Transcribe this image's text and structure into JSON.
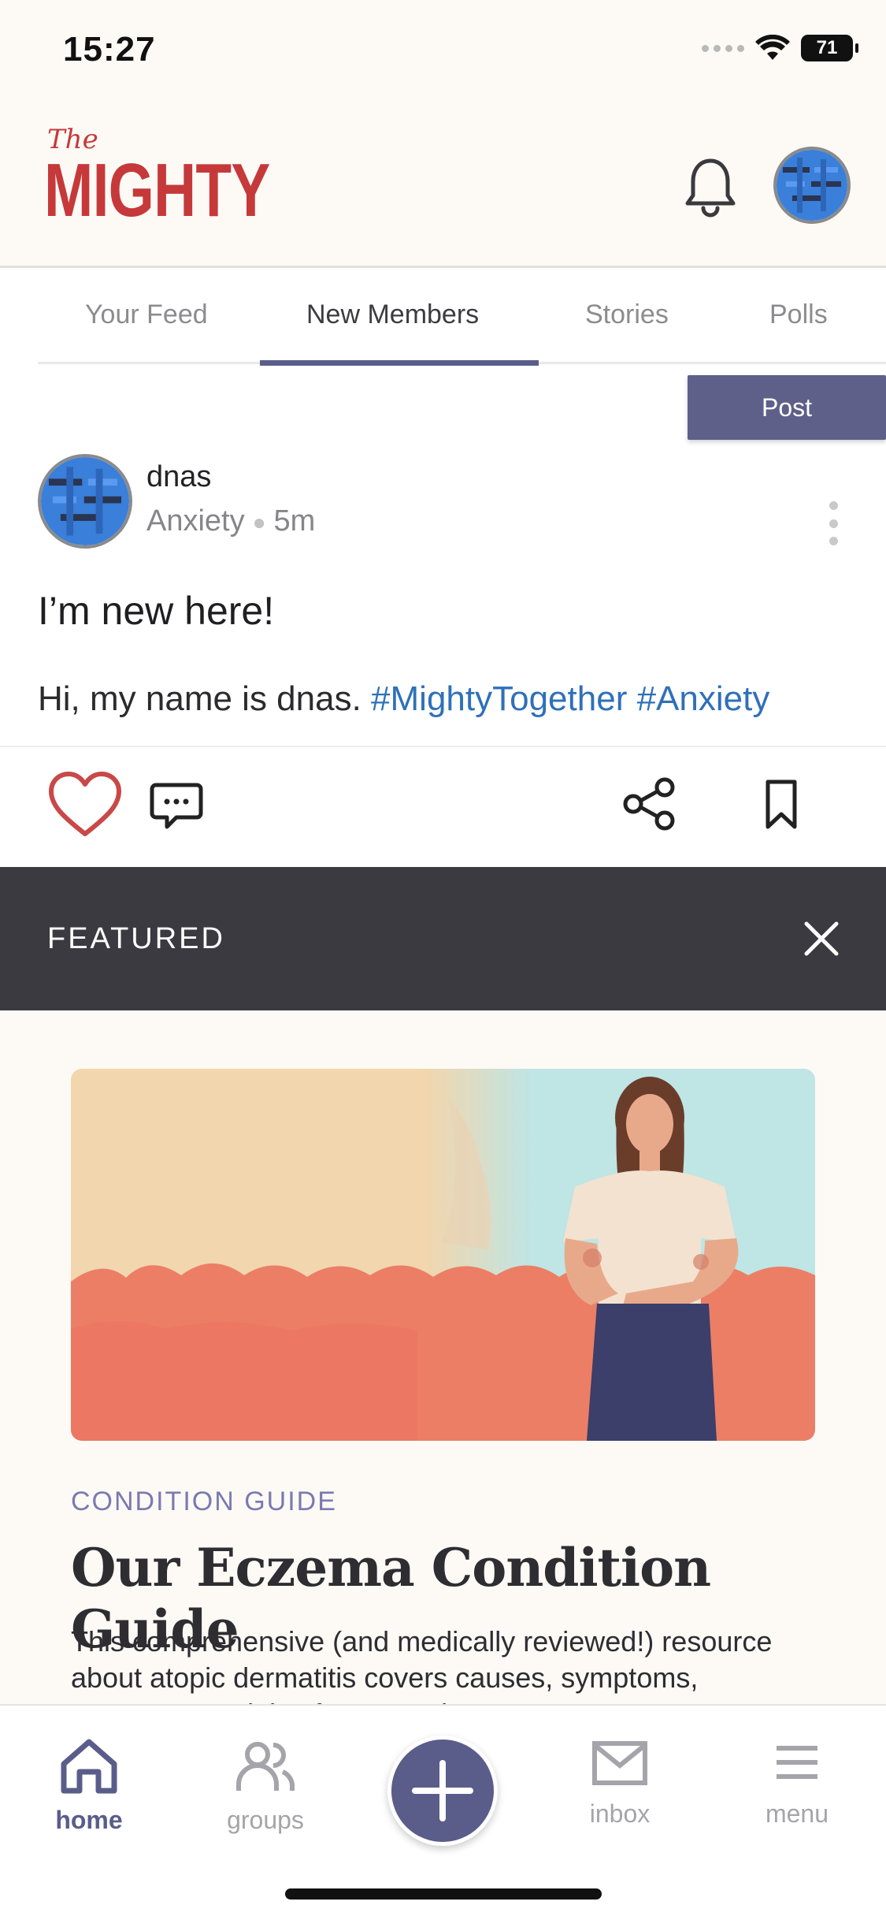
{
  "status_bar": {
    "time": "15:27",
    "battery": "71"
  },
  "header": {
    "logo_the": "The",
    "logo_main": "MIGHTY"
  },
  "tabs": [
    {
      "label": "Your Feed"
    },
    {
      "label": "New Members"
    },
    {
      "label": "Stories"
    },
    {
      "label": "Polls"
    }
  ],
  "post": {
    "post_button": "Post",
    "author": "dnas",
    "community": "Anxiety",
    "time_ago": "5m",
    "title": "I’m new here!",
    "body_text": "Hi, my name is dnas.",
    "hashtags": [
      "#MightyTogether",
      "#Anxiety"
    ]
  },
  "featured": {
    "label": "FEATURED",
    "category": "CONDITION GUIDE",
    "title": "Our Eczema Condition Guide",
    "description": "This comprehensive (and medically reviewed!) resource about atopic dermatitis covers causes, symptoms, treatment, and tips for managing eczema."
  },
  "bottom_nav": {
    "home": "home",
    "groups": "groups",
    "inbox": "inbox",
    "menu": "menu"
  },
  "colors": {
    "brand_red": "#c6393a",
    "accent_purple": "#5a5d8a",
    "hashtag_blue": "#2f70b9",
    "featured_bar": "#3a3a40"
  }
}
